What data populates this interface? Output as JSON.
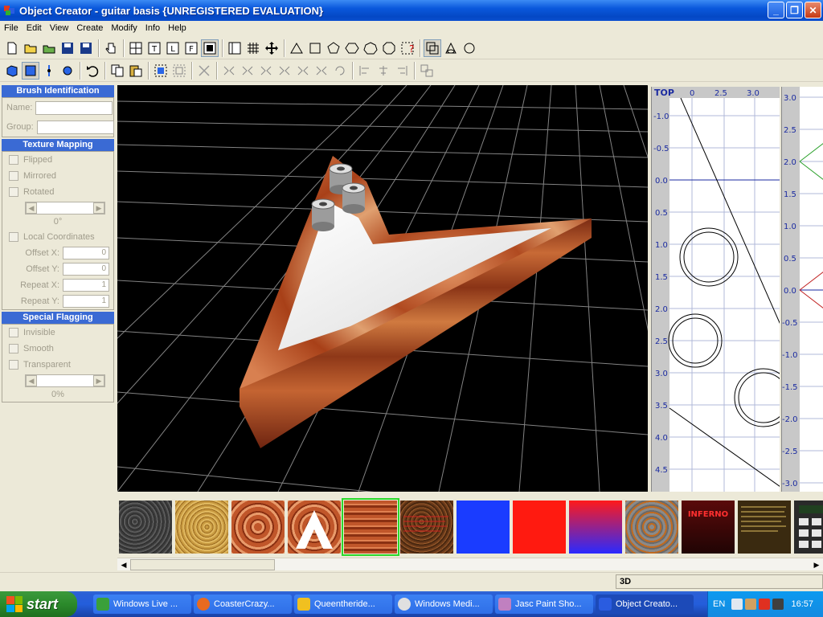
{
  "window": {
    "title": "Object Creator - guitar basis {UNREGISTERED EVALUATION}",
    "minimize": "_",
    "restore": "❐",
    "close": "✕"
  },
  "menu": [
    "File",
    "Edit",
    "View",
    "Create",
    "Modify",
    "Info",
    "Help"
  ],
  "left_panel": {
    "brush": {
      "title": "Brush Identification",
      "name_label": "Name:",
      "group_label": "Group:"
    },
    "texture": {
      "title": "Texture Mapping",
      "flipped": "Flipped",
      "mirrored": "Mirrored",
      "rotated": "Rotated",
      "rotation_value": "0°",
      "local_coords": "Local Coordinates",
      "offset_x_label": "Offset X:",
      "offset_x": "0",
      "offset_y_label": "Offset Y:",
      "offset_y": "0",
      "repeat_x_label": "Repeat X:",
      "repeat_x": "1",
      "repeat_y_label": "Repeat Y:",
      "repeat_y": "1"
    },
    "flagging": {
      "title": "Special Flagging",
      "invisible": "Invisible",
      "smooth": "Smooth",
      "transparent": "Transparent",
      "transparency_value": "0%"
    }
  },
  "top_view": {
    "label": "TOP",
    "x_ticks": [
      "0",
      "2.5",
      "3.0"
    ],
    "y_ticks": [
      "-1.0",
      "-0.5",
      "0.0",
      "0.5",
      "1.0",
      "1.5",
      "2.0",
      "2.5",
      "3.0",
      "3.5",
      "4.0",
      "4.5"
    ]
  },
  "side_view": {
    "y_ticks": [
      "3.0",
      "2.5",
      "2.0",
      "1.5",
      "1.0",
      "0.5",
      "0.0",
      "-0.5",
      "-1.0",
      "-1.5",
      "-2.0",
      "-2.5",
      "-3.0"
    ]
  },
  "textures": {
    "inferno_label": "INFERNO",
    "selected_index": 4
  },
  "statusbar": {
    "mode": "3D"
  },
  "taskbar": {
    "start": "start",
    "tasks": [
      "Windows Live ...",
      "CoasterCrazy...",
      "Queentheride...",
      "Windows Medi...",
      "Jasc Paint Sho...",
      "Object Creato..."
    ],
    "lang": "EN",
    "clock": "16:57"
  },
  "colors": {
    "wood": "#b8562a",
    "grid": "#c0c0c0",
    "title_blue": "#0a58dc",
    "selection_green": "#2bd92b"
  }
}
